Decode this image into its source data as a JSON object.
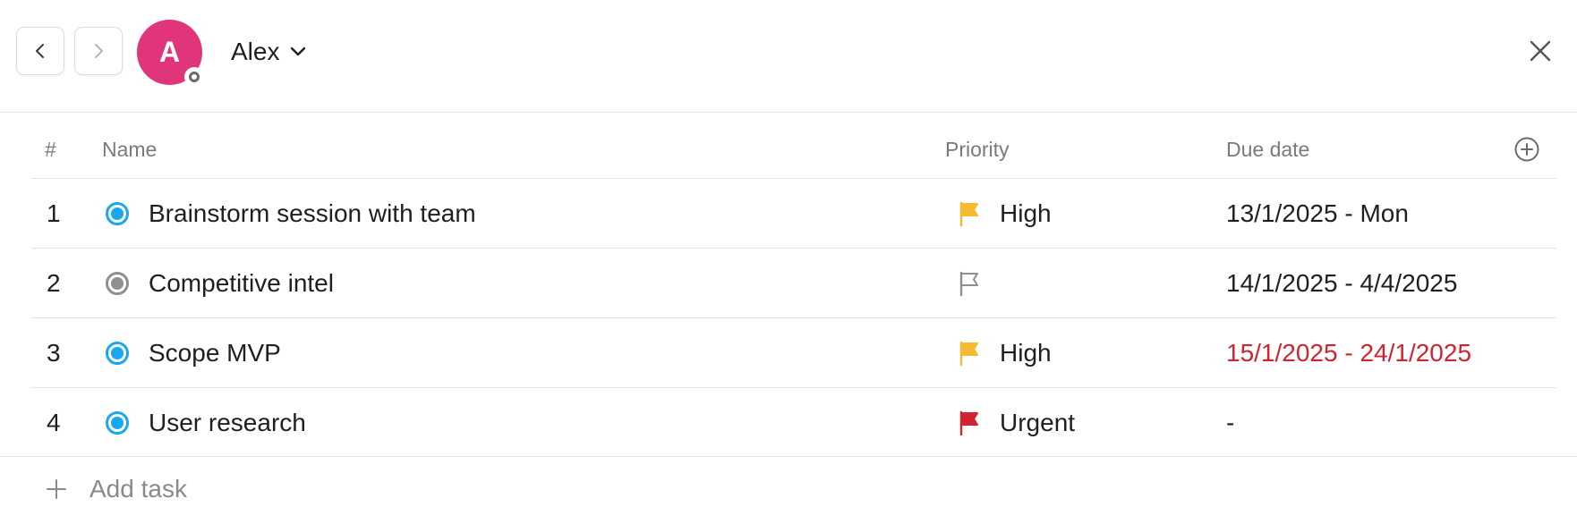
{
  "header": {
    "back_icon": "chevron-left-icon",
    "forward_icon": "chevron-right-icon",
    "avatar": {
      "initial": "A",
      "color": "#e0357a"
    },
    "user_name": "Alex",
    "dropdown_icon": "chevron-down-icon",
    "close_icon": "close-icon"
  },
  "table": {
    "columns": {
      "num": "#",
      "name": "Name",
      "priority": "Priority",
      "due": "Due date"
    },
    "add_column_icon": "plus-circle-icon",
    "rows": [
      {
        "num": "1",
        "name": "Brainstorm session with team",
        "status": "in-progress",
        "status_color": "#19a7f2",
        "priority": "High",
        "flag_color": "#f6b930",
        "due": "13/1/2025 - Mon",
        "due_color": "#1f1f1f"
      },
      {
        "num": "2",
        "name": "Competitive intel",
        "status": "not-started",
        "status_color": "#8f8f8f",
        "priority": "",
        "flag_color": "#8f8f8f",
        "flag_outline": true,
        "due": "14/1/2025 - 4/4/2025",
        "due_color": "#1f1f1f"
      },
      {
        "num": "3",
        "name": "Scope MVP",
        "status": "in-progress",
        "status_color": "#19a7f2",
        "priority": "High",
        "flag_color": "#f6b930",
        "due": "15/1/2025 - 24/1/2025",
        "due_color": "#d1242f"
      },
      {
        "num": "4",
        "name": "User research",
        "status": "in-progress",
        "status_color": "#19a7f2",
        "priority": "Urgent",
        "flag_color": "#d1242f",
        "due": "-",
        "due_color": "#1f1f1f"
      }
    ]
  },
  "footer": {
    "add_task_label": "Add task",
    "add_icon": "plus-icon"
  }
}
